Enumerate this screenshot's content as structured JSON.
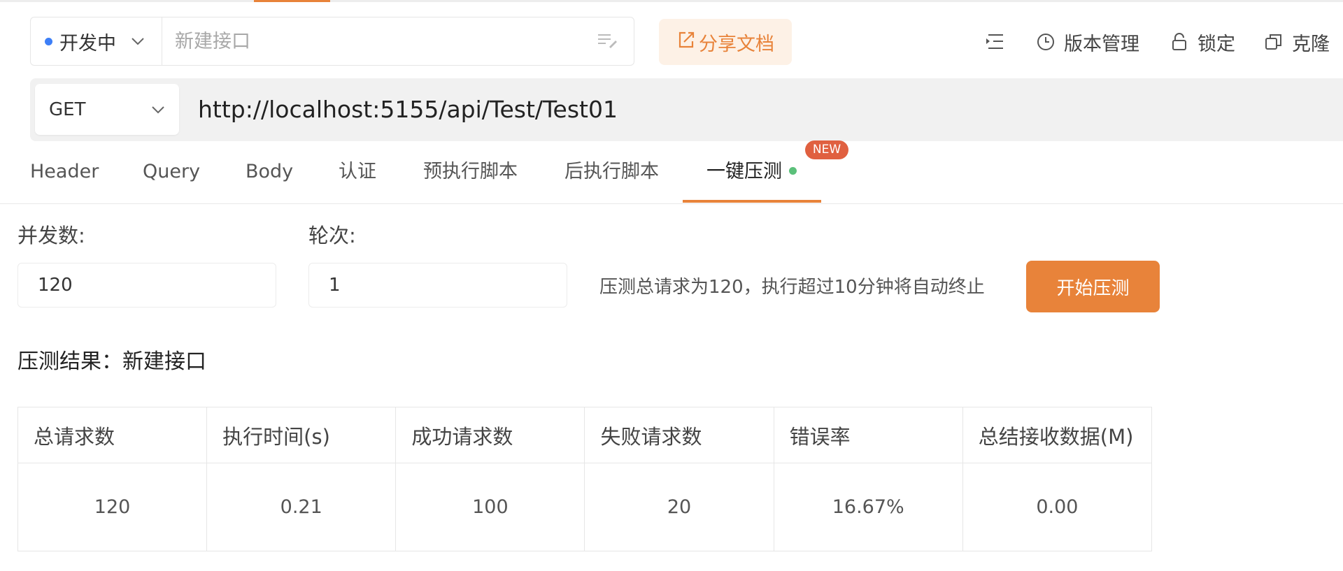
{
  "status": {
    "label": "开发中",
    "dot_color": "#3d7ff7"
  },
  "api_name": {
    "value": "",
    "placeholder": "新建接口"
  },
  "share_label": "分享文档",
  "toolbar": {
    "version_label": "版本管理",
    "lock_label": "锁定",
    "clone_label": "克隆"
  },
  "request": {
    "method": "GET",
    "url": "http://localhost:5155/api/Test/Test01"
  },
  "tabs": [
    {
      "label": "Header"
    },
    {
      "label": "Query"
    },
    {
      "label": "Body"
    },
    {
      "label": "认证"
    },
    {
      "label": "预执行脚本"
    },
    {
      "label": "后执行脚本"
    },
    {
      "label": "一键压测",
      "active": true,
      "badge": "NEW"
    }
  ],
  "stress": {
    "concurrency_label": "并发数:",
    "concurrency_value": "120",
    "rounds_label": "轮次:",
    "rounds_value": "1",
    "hint": "压测总请求为120，执行超过10分钟将自动终止",
    "start_label": "开始压测"
  },
  "results": {
    "title": "压测结果：新建接口",
    "columns": [
      "总请求数",
      "执行时间(s)",
      "成功请求数",
      "失败请求数",
      "错误率",
      "总结接收数据(M)"
    ],
    "row": [
      "120",
      "0.21",
      "100",
      "20",
      "16.67%",
      "0.00"
    ]
  },
  "colors": {
    "accent": "#e8833a",
    "badge": "#e06040",
    "live_dot": "#5bc07a"
  }
}
